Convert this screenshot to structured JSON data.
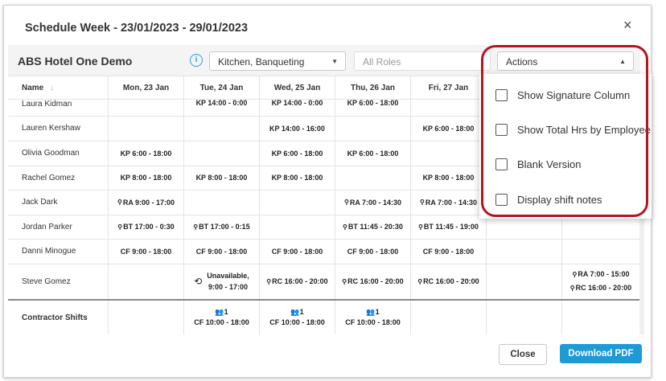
{
  "modal": {
    "title": "Schedule Week - 23/01/2023 - 29/01/2023",
    "close_glyph": "×"
  },
  "toolbar": {
    "hotel_name": "ABS Hotel One Demo",
    "info_glyph": "i",
    "department_select": "Kitchen, Banqueting",
    "roles_placeholder": "All Roles",
    "actions_label": "Actions"
  },
  "table": {
    "headers": [
      "Name",
      "Mon, 23 Jan",
      "Tue, 24 Jan",
      "Wed, 25 Jan",
      "Thu, 26 Jan",
      "Fri, 27 Jan",
      "",
      ""
    ],
    "rows": [
      {
        "name": "Laura Kidman",
        "cells": [
          "",
          "KP 14:00 - 0:00",
          "KP 14:00 - 0:00",
          "KP 6:00 - 18:00",
          "",
          "",
          ""
        ]
      },
      {
        "name": "Lauren Kershaw",
        "cells": [
          "",
          "",
          "KP 14:00 - 16:00",
          "",
          "KP 6:00 - 18:00",
          "",
          ""
        ]
      },
      {
        "name": "Olivia Goodman",
        "cells": [
          "KP 6:00 - 18:00",
          "",
          "KP 6:00 - 18:00",
          "KP 6:00 - 18:00",
          "",
          "",
          ""
        ]
      },
      {
        "name": "Rachel Gomez",
        "cells": [
          "KP 8:00 - 18:00",
          "KP 8:00 - 18:00",
          "KP 8:00 - 18:00",
          "",
          "KP 8:00 - 18:00",
          "",
          ""
        ]
      },
      {
        "name": "Jack Dark",
        "cells": [
          "RA 9:00 - 17:00",
          "",
          "",
          "RA 7:00 - 14:30",
          "RA 7:00 - 14:30",
          "",
          ""
        ]
      },
      {
        "name": "Jordan Parker",
        "cells": [
          "BT 17:00 - 0:30",
          "BT 17:00 - 0:15",
          "",
          "BT 11:45 - 20:30",
          "BT 11:45 - 19:00",
          "",
          ""
        ]
      },
      {
        "name": "Danni Minogue",
        "cells": [
          "CF 9:00 - 18:00",
          "CF 9:00 - 18:00",
          "CF 9:00 - 18:00",
          "CF 9:00 - 18:00",
          "CF 9:00 - 18:00",
          "",
          ""
        ]
      },
      {
        "name": "Steve Gomez",
        "cells": [
          "",
          "Unavailable,",
          "RC 16:00 - 20:00",
          "RC 16:00 - 20:00",
          "RC 16:00 - 20:00",
          "",
          "RA 7:00 - 15:00"
        ],
        "extra": {
          "tue_line2": "9:00 - 17:00",
          "sun_line2": "RC 16:00 - 20:00"
        }
      },
      {
        "name": "Contractor Shifts",
        "count": "1",
        "cells": [
          "",
          "CF 10:00 - 18:00",
          "CF 10:00 - 18:00",
          "CF 10:00 - 18:00",
          "",
          "",
          ""
        ]
      }
    ]
  },
  "dropdown": {
    "items": [
      "Show Signature Column",
      "Show Total Hrs by Employee",
      "Blank Version",
      "Display shift notes"
    ]
  },
  "footer": {
    "close_label": "Close",
    "download_label": "Download PDF"
  },
  "colors": {
    "accent": "#1e9ad6",
    "highlight": "#b3161e"
  }
}
